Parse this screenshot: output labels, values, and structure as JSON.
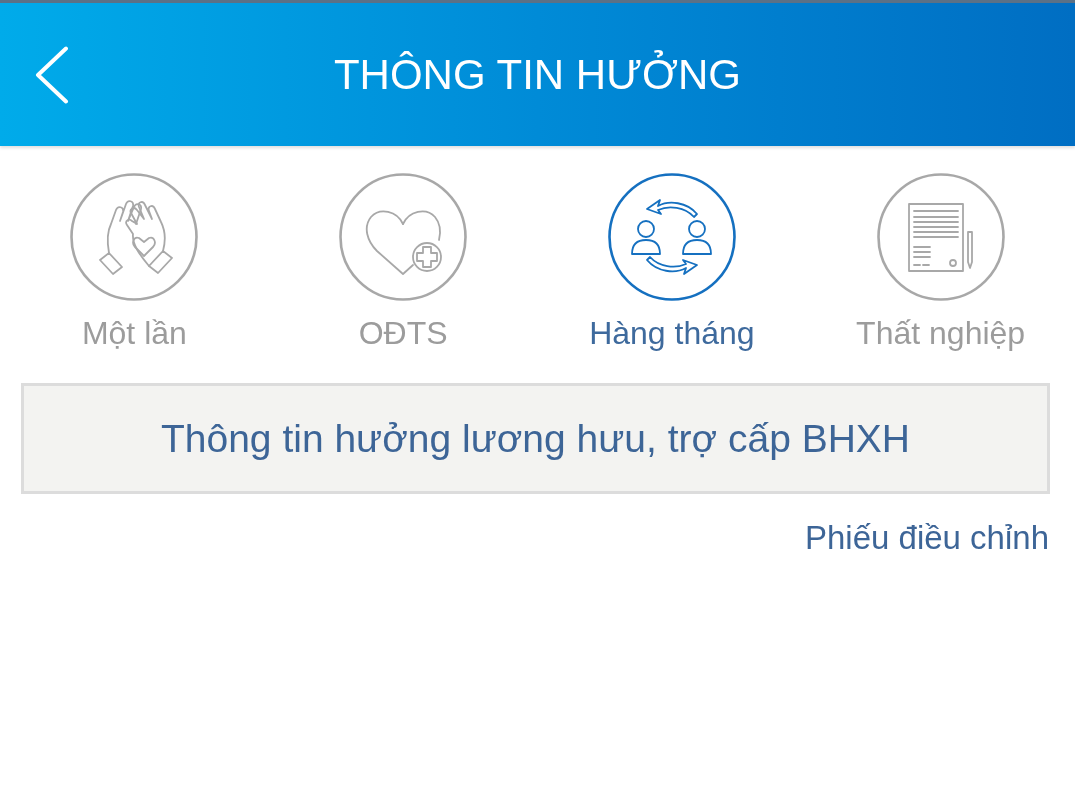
{
  "header": {
    "title": "THÔNG TIN HƯỞNG"
  },
  "tabs": [
    {
      "label": "Một lần",
      "kind": "hands",
      "selected": false
    },
    {
      "label": "OĐTS",
      "kind": "heart",
      "selected": false
    },
    {
      "label": "Hàng tháng",
      "kind": "exchange",
      "selected": true
    },
    {
      "label": "Thất nghiệp",
      "kind": "document",
      "selected": false
    }
  ],
  "banner": {
    "text": "Thông tin hưởng lương hưu, trợ cấp BHXH"
  },
  "link": {
    "text": "Phiếu điều chỉnh"
  }
}
